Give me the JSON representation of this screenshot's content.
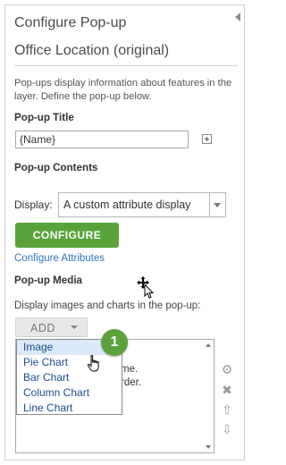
{
  "header": {
    "title": "Configure Pop-up",
    "subtitle": "Office Location (original)"
  },
  "description": "Pop-ups display information about features in the layer. Define the pop-up below.",
  "popup_title": {
    "label": "Pop-up Title",
    "value": "{Name}"
  },
  "popup_contents": {
    "label": "Pop-up Contents",
    "display_label": "Display:",
    "display_value": "A custom attribute display",
    "configure_label": "CONFIGURE",
    "configure_attributes_link": "Configure Attributes"
  },
  "popup_media": {
    "label": "Pop-up Media",
    "description": "Display images and charts in the pop-up:",
    "add_label": "ADD",
    "list_fragments": [
      "me.",
      "rder."
    ],
    "menu_options": [
      "Image",
      "Pie Chart",
      "Bar Chart",
      "Column Chart",
      "Line Chart"
    ],
    "highlighted_option": "Image"
  },
  "callout_badge": "1",
  "icons": {
    "collapse": "collapse-arrow-left-icon",
    "add_expression": "plus-icon",
    "settings": "gear-icon",
    "delete": "delete-x-icon",
    "move_up": "arrow-up-icon",
    "move_down": "arrow-down-icon"
  },
  "colors": {
    "accent_green": "#5aa33b",
    "link_blue": "#2e76b8",
    "menu_text": "#1a4e8a",
    "menu_highlight": "#dce9f8"
  }
}
